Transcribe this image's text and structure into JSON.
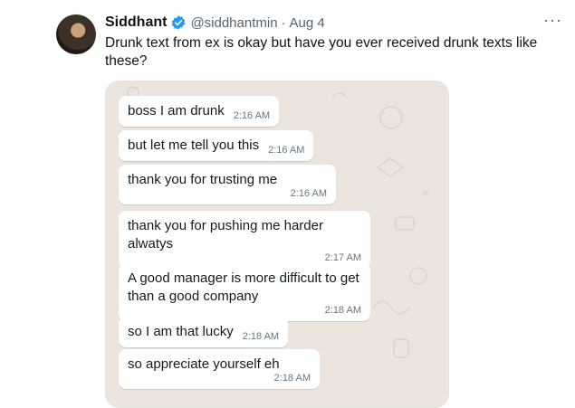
{
  "tweet": {
    "author_name": "Siddhant",
    "handle": "@siddhantmin",
    "separator": "·",
    "date": "Aug 4",
    "more": "···",
    "text": "Drunk text from ex is okay but have you ever received drunk texts like these?"
  },
  "colors": {
    "verified": "#1d9bf0",
    "chat_background": "#ece5dd",
    "bubble": "#ffffff",
    "timestamp": "#667781"
  },
  "icons": {
    "verified": "verified-badge-icon",
    "more": "more-options-icon"
  },
  "chat": {
    "messages": [
      {
        "text": "boss I am drunk",
        "time": "2:16 AM"
      },
      {
        "text": "but let me tell you this",
        "time": "2:16 AM"
      },
      {
        "text": "thank you for trusting me",
        "time": "2:16 AM"
      },
      {
        "text": "thank you for pushing me harder alwatys",
        "time": "2:17 AM"
      },
      {
        "text": "A good manager is more difficult to get than a good company",
        "time": "2:18 AM"
      },
      {
        "text": "so I am that lucky",
        "time": "2:18 AM"
      },
      {
        "text": "so appreciate yourself eh",
        "time": "2:18 AM"
      }
    ]
  }
}
